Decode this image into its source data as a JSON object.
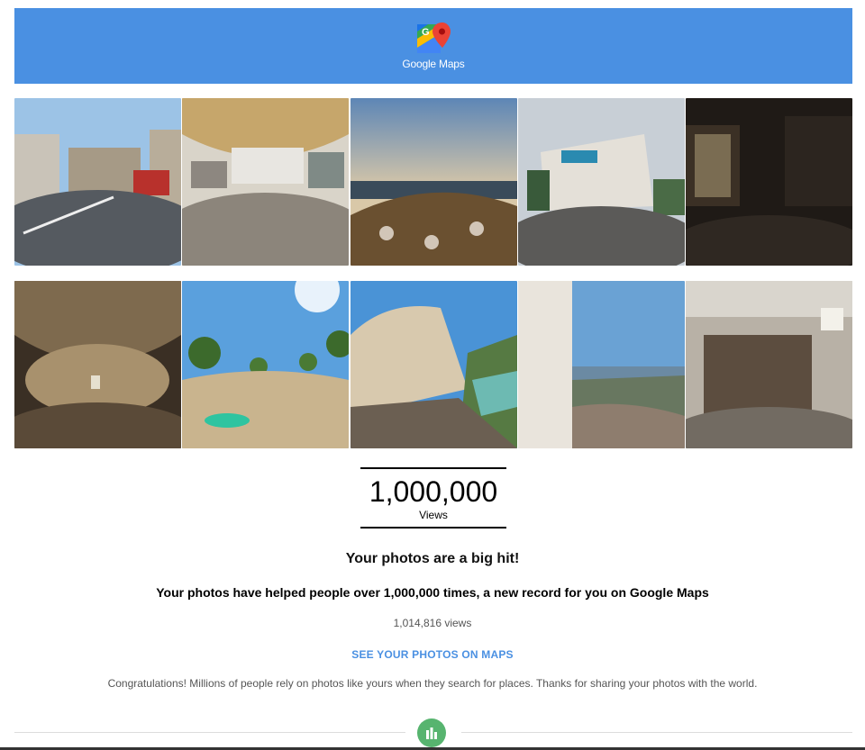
{
  "header": {
    "brand": "Google Maps",
    "icon": "google-maps-pin-icon",
    "bg_color": "#4a90e2"
  },
  "photos": {
    "row1": [
      {
        "name": "street-panorama-photo"
      },
      {
        "name": "plaza-canopy-panorama-photo"
      },
      {
        "name": "coastal-cliff-panorama-photo"
      },
      {
        "name": "aquarium-building-panorama-photo"
      },
      {
        "name": "bar-interior-panorama-photo"
      }
    ],
    "row2": [
      {
        "name": "cave-panorama-photo"
      },
      {
        "name": "park-trees-panorama-photo"
      },
      {
        "name": "mountain-gorge-panorama-photo"
      },
      {
        "name": "city-overlook-panorama-photo"
      },
      {
        "name": "wine-cellar-panorama-photo"
      }
    ]
  },
  "milestone": {
    "number": "1,000,000",
    "label": "Views"
  },
  "headline": "Your photos are a big hit!",
  "subhead": "Your photos have helped people over 1,000,000 times, a new record for you on Google Maps",
  "view_count": "1,014,816 views",
  "cta_label": "SEE YOUR PHOTOS ON MAPS",
  "congrats": "Congratulations! Millions of people rely on photos like yours when they search for places. Thanks for sharing your photos with the world.",
  "footer": {
    "icon": "stats-bar-chart-icon",
    "icon_color": "#57b46f"
  }
}
